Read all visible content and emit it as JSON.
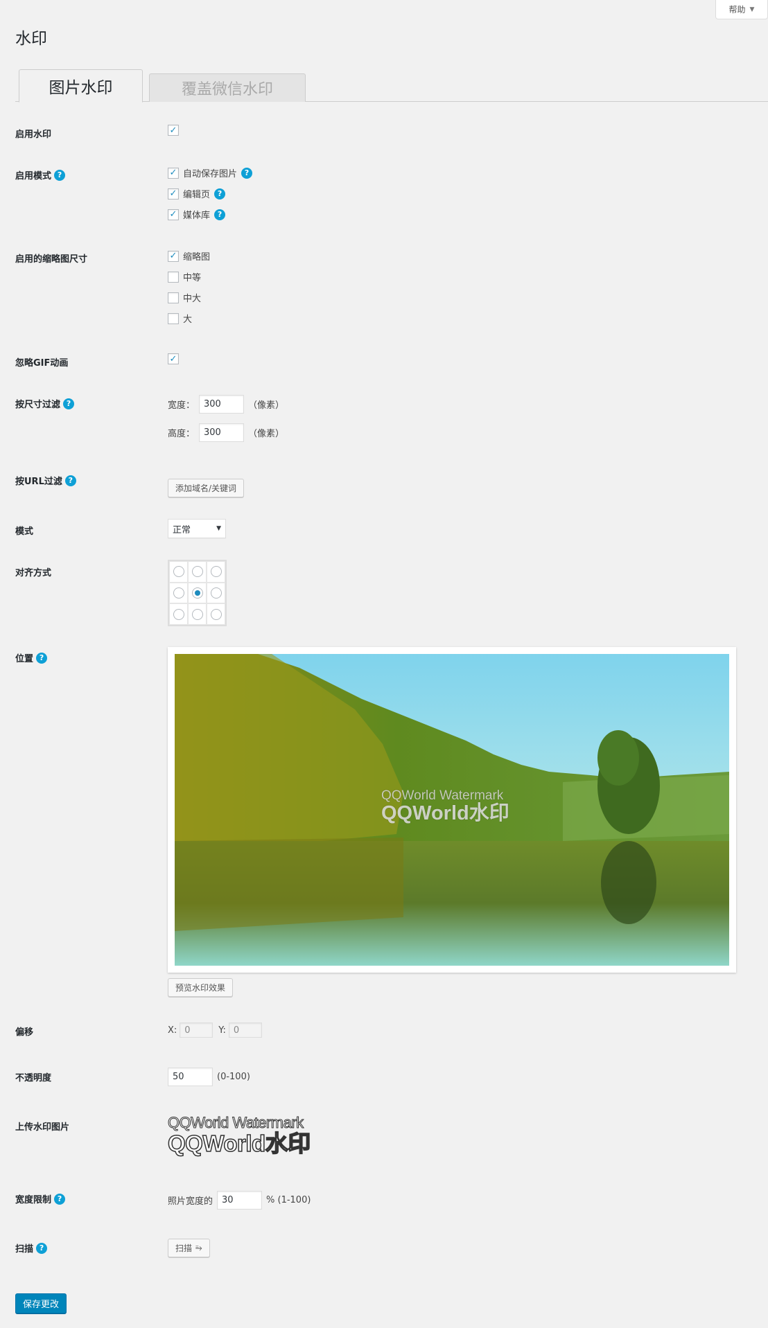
{
  "help": {
    "label": "帮助",
    "arrow": "▼"
  },
  "page_title": "水印",
  "tabs": [
    {
      "label": "图片水印",
      "active": true
    },
    {
      "label": "覆盖微信水印",
      "active": false
    }
  ],
  "settings": {
    "enable": {
      "label": "启用水印",
      "checked": true
    },
    "modes": {
      "label": "启用模式",
      "options": [
        {
          "label": "自动保存图片",
          "checked": true,
          "help": true
        },
        {
          "label": "编辑页",
          "checked": true,
          "help": true
        },
        {
          "label": "媒体库",
          "checked": true,
          "help": true
        }
      ]
    },
    "thumb_sizes": {
      "label": "启用的缩略图尺寸",
      "options": [
        {
          "label": "缩略图",
          "checked": true
        },
        {
          "label": "中等",
          "checked": false
        },
        {
          "label": "中大",
          "checked": false
        },
        {
          "label": "大",
          "checked": false
        }
      ]
    },
    "ignore_gif": {
      "label": "忽略GIF动画",
      "checked": true
    },
    "size_filter": {
      "label": "按尺寸过滤",
      "width_label": "宽度：",
      "width_value": "300",
      "height_label": "高度：",
      "height_value": "300",
      "unit": "（像素）"
    },
    "url_filter": {
      "label": "按URL过滤",
      "button": "添加域名/关键词"
    },
    "mode": {
      "label": "模式",
      "value": "正常",
      "arrow": "▼"
    },
    "alignment": {
      "label": "对齐方式",
      "selected": 4
    },
    "position": {
      "label": "位置",
      "preview_button": "预览水印效果",
      "watermark_line1": "QQWorld Watermark",
      "watermark_line2": "QQWorld水印"
    },
    "offset": {
      "label": "偏移",
      "x_label": "X:",
      "x_value": "0",
      "y_label": "Y:",
      "y_value": "0"
    },
    "opacity": {
      "label": "不透明度",
      "value": "50",
      "range": "(0-100)"
    },
    "upload": {
      "label": "上传水印图片",
      "line1": "QQWorld Watermark",
      "line2": "QQWorld水印"
    },
    "width_limit": {
      "label": "宽度限制",
      "prefix": "照片宽度的",
      "value": "30",
      "suffix": "% (1-100)"
    },
    "scan": {
      "label": "扫描",
      "button": "扫描",
      "icon": "⥱"
    }
  },
  "save_button": "保存更改",
  "colors": {
    "accent": "#0085ba",
    "help_icon": "#0ea0d6",
    "checkmark": "#1e8cbe"
  }
}
